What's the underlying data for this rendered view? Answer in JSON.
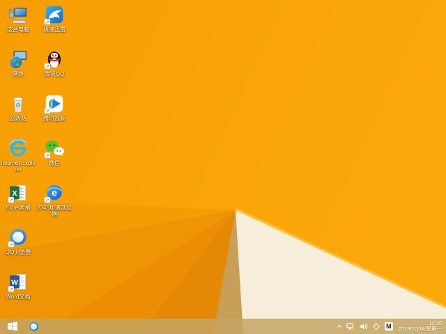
{
  "desktop": {
    "icons": [
      {
        "name": "this-pc",
        "label": "这台电脑"
      },
      {
        "name": "xunlei-thunder",
        "label": "极速迅雷"
      },
      {
        "name": "network",
        "label": "网络"
      },
      {
        "name": "tencent-qq",
        "label": "腾讯QQ"
      },
      {
        "name": "recycle-bin",
        "label": "回收站"
      },
      {
        "name": "tencent-video",
        "label": "腾讯视频"
      },
      {
        "name": "internet-explorer",
        "label": "Internet Explorer"
      },
      {
        "name": "wechat",
        "label": "微信"
      },
      {
        "name": "excel",
        "label": "Excel表格"
      },
      {
        "name": "2345-browser",
        "label": "2345加速浏览器"
      },
      {
        "name": "qq-browser",
        "label": "QQ浏览器"
      },
      {
        "name": "word",
        "label": "Word文档"
      }
    ]
  },
  "taskbar": {
    "pinned": [
      "qq-browser"
    ],
    "tray_icons": [
      "show-hidden-chevron",
      "network-status-warning",
      "volume",
      "touchpad",
      "ime-microsoft-pinyin"
    ],
    "clock": {
      "time": "12:30",
      "date": "2019/10/14 星期一"
    }
  },
  "glyphs": {
    "excel": "X",
    "word": "W",
    "browser_e": "e",
    "ime": "M",
    "recycle": "♻",
    "shortcut_arrow": "↗"
  },
  "wallpaper_colors": {
    "base": "#f8a002",
    "base_light": "#fba80a",
    "wedge_dark": "#e58806",
    "tan_sliver": "#c6a058",
    "cream_triangle": "#f6eeda",
    "edge_highlight": "#ffbf35",
    "taskbar_tint": "#c4a464"
  }
}
